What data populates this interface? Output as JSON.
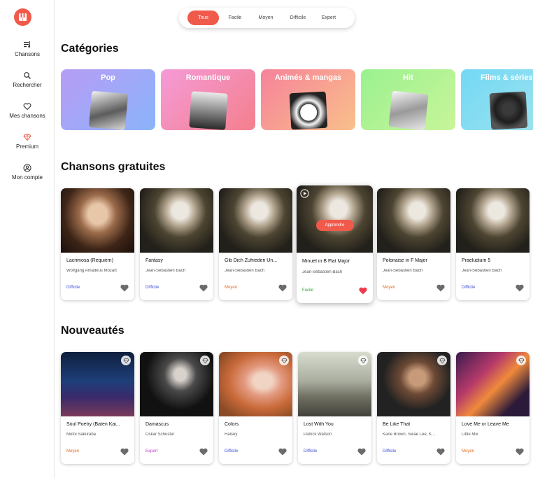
{
  "sidebar": {
    "items": [
      {
        "label": "Chansons",
        "icon": "music-list-icon"
      },
      {
        "label": "Rechercher",
        "icon": "search-icon"
      },
      {
        "label": "Mes chansons",
        "icon": "heart-icon"
      },
      {
        "label": "Premium",
        "icon": "diamond-icon"
      },
      {
        "label": "Mon compte",
        "icon": "user-icon"
      }
    ]
  },
  "filters": {
    "options": [
      "Tous",
      "Facile",
      "Moyen",
      "Difficile",
      "Expert"
    ],
    "selected": "Tous"
  },
  "sections": {
    "categories": "Catégories",
    "free_songs": "Chansons gratuites",
    "new_songs": "Nouveautés"
  },
  "categories": [
    {
      "name": "Pop"
    },
    {
      "name": "Romantique"
    },
    {
      "name": "Animés & mangas"
    },
    {
      "name": "Hit"
    },
    {
      "name": "Films & séries"
    }
  ],
  "free_songs": [
    {
      "title": "Lacrimosa (Requiem)",
      "artist": "Wolfgang Amadeus Mozart",
      "level": "Difficile",
      "favorite": false
    },
    {
      "title": "Fantasy",
      "artist": "Jean-Sébastien Bach",
      "level": "Difficile",
      "favorite": false
    },
    {
      "title": "Gib Dich Zufrieden Un...",
      "artist": "Jean-Sébastien Bach",
      "level": "Moyen",
      "favorite": false
    },
    {
      "title": "Minuet in B Flat Major",
      "artist": "Jean-Sébastien Bach",
      "level": "Facile",
      "favorite": true,
      "action": "Apprendre"
    },
    {
      "title": "Polonaise in F Major",
      "artist": "Jean-Sébastien Bach",
      "level": "Moyen",
      "favorite": false
    },
    {
      "title": "Praeludium 5",
      "artist": "Jean-Sébastien Bach",
      "level": "Difficile",
      "favorite": false
    }
  ],
  "new_songs": [
    {
      "title": "Soul Poetry (Baten Kai...",
      "artist": "Motoi Sakuraba",
      "level": "Moyen",
      "premium": true
    },
    {
      "title": "Damascus",
      "artist": "Oskar Schuster",
      "level": "Expert",
      "premium": true
    },
    {
      "title": "Colors",
      "artist": "Halsey",
      "level": "Difficile",
      "premium": true
    },
    {
      "title": "Lost With You",
      "artist": "Patrick Watson",
      "level": "Difficile",
      "premium": true
    },
    {
      "title": "Be Like That",
      "artist": "Kane Brown, Swae Lee, K...",
      "level": "Difficile",
      "premium": true
    },
    {
      "title": "Love Me or Leave Me",
      "artist": "Little Mix",
      "level": "Moyen",
      "premium": true
    }
  ],
  "colors": {
    "accent": "#f05a4b",
    "level_difficile": "#3b4fd1",
    "level_moyen": "#e06b21",
    "level_facile": "#2fa33b",
    "level_expert": "#c63fcb"
  }
}
